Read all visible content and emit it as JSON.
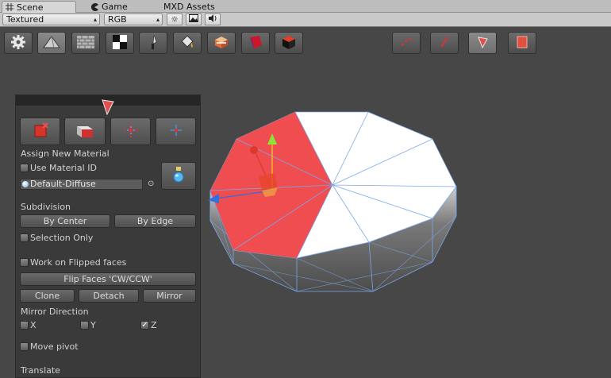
{
  "tabs": [
    {
      "label": "Scene",
      "icon": "grid-icon"
    },
    {
      "label": "Game",
      "icon": "pacman-icon"
    },
    {
      "label": "MXD Assets",
      "icon": ""
    }
  ],
  "scene_toolbar": {
    "render_mode": "Textured",
    "color_mode": "RGB",
    "buttons": [
      "sun-icon",
      "image-icon",
      "speaker-icon"
    ]
  },
  "main_tools": [
    "gear-icon",
    "pyramid-icon",
    "brick-wall-icon",
    "checker-icon",
    "knife-icon",
    "paint-bucket-icon",
    "material-box-icon",
    "red-shape-icon",
    "black-cube-icon"
  ],
  "select_modes": [
    "vertex-mode-icon",
    "edge-mode-icon",
    "face-mode-icon",
    "object-mode-icon"
  ],
  "panel": {
    "assign_new_material": "Assign New Material",
    "use_material_id": "Use Material ID",
    "material_value": "Default-Diffuse",
    "subdivision": "Subdivision",
    "by_center": "By Center",
    "by_edge": "By Edge",
    "selection_only": "Selection Only",
    "work_on_flipped": "Work on Flipped faces",
    "flip_faces": "Flip Faces 'CW/CCW'",
    "clone": "Clone",
    "detach": "Detach",
    "mirror": "Mirror",
    "mirror_direction": "Mirror Direction",
    "axis_x": "X",
    "axis_y": "Y",
    "axis_z": "Z",
    "axis_z_checked": true,
    "move_pivot": "Move pivot",
    "translate": "Translate"
  },
  "colors": {
    "selected_face": "#ef4d4f",
    "wire": "#7aa7e8",
    "gizmo_y": "#8ee33a",
    "gizmo_x": "#d93a2a",
    "gizmo_z": "#2f6fe0"
  }
}
